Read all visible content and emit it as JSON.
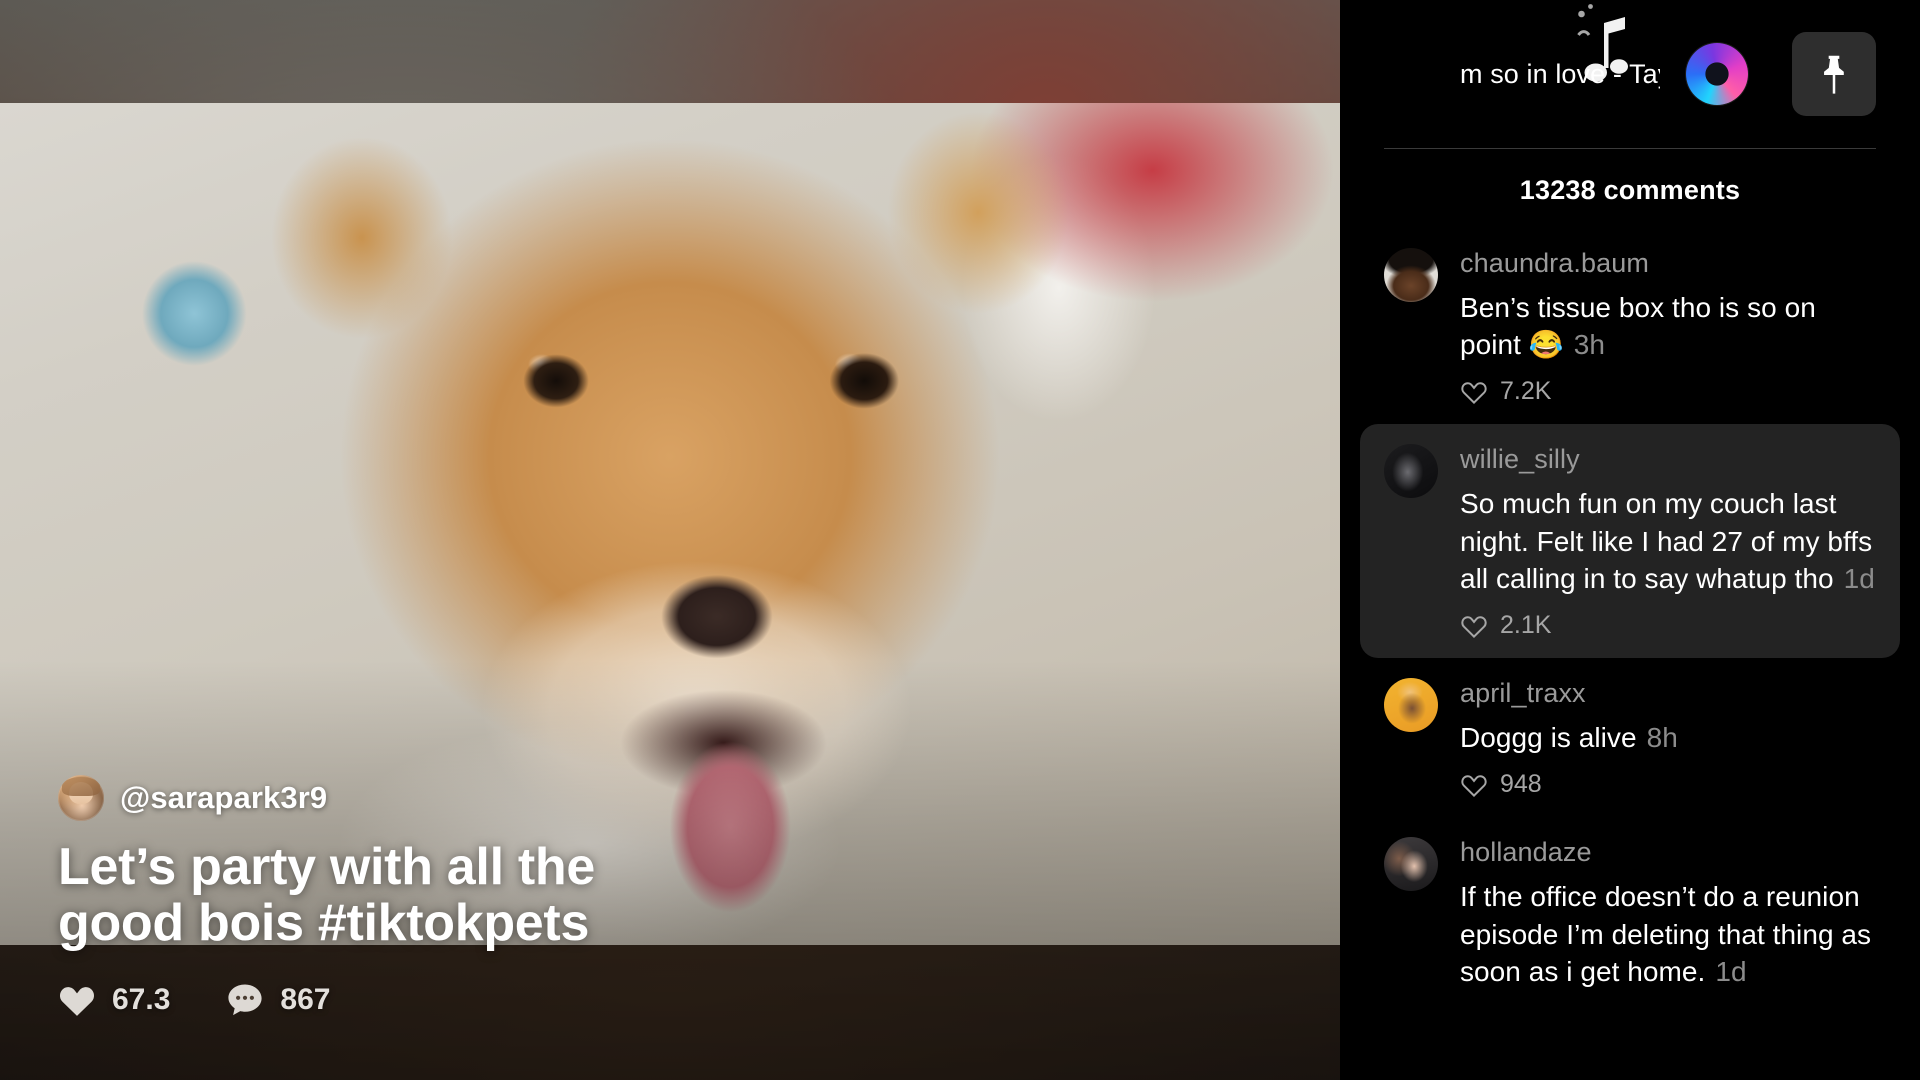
{
  "video": {
    "author_handle": "@sarapark3r9",
    "caption": "Let’s party with all the good bois #tiktokpets",
    "likes": "67.3",
    "comments": "867",
    "heart_icon": "heart-icon",
    "comment_icon": "comment-bubble-icon",
    "avatar_icon": "author-avatar"
  },
  "panel": {
    "music_title": "m so in love - Taylo",
    "music_note_icon": "music-note-icon",
    "music_disc_icon": "music-disc-icon",
    "pin_icon": "pin-icon",
    "comment_count": "13238 comments"
  },
  "comments": [
    {
      "user": "chaundra.baum",
      "text": "Ben’s tissue box tho is so on point 😂",
      "time": "3h",
      "likes": "7.2K",
      "highlight": false,
      "avatar": "avatar-chaundra-baum"
    },
    {
      "user": "willie_silly",
      "text": "So much fun on my couch last night. Felt like I had 27 of my bffs all calling in to say whatup tho",
      "time": "1d",
      "likes": "2.1K",
      "highlight": true,
      "avatar": "avatar-willie-silly"
    },
    {
      "user": "april_traxx",
      "text": "Doggg is alive",
      "time": "8h",
      "likes": "948",
      "highlight": false,
      "avatar": "avatar-april-traxx"
    },
    {
      "user": "hollandaze",
      "text": "If the office doesn’t do a reunion episode I’m deleting that thing as soon as i get home.",
      "time": "1d",
      "likes": "",
      "highlight": false,
      "avatar": "avatar-hollandaze"
    }
  ],
  "colors": {
    "panel_bg": "#000000",
    "highlight_bg": "#232323",
    "username": "#9a9a9a",
    "pin_btn": "#2e2e2e"
  }
}
